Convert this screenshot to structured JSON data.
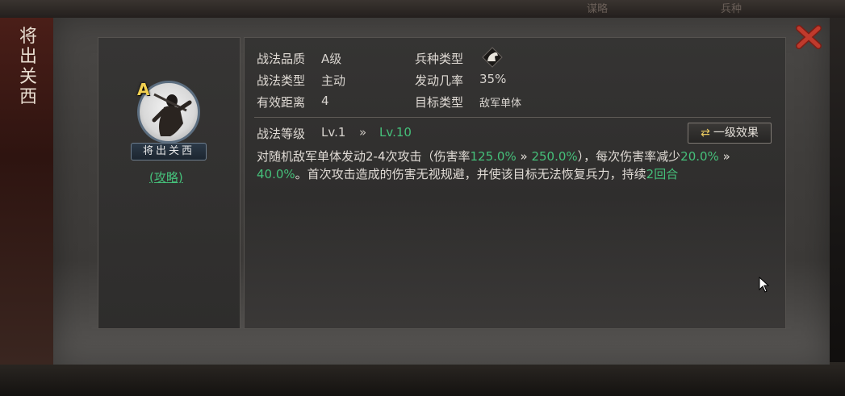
{
  "background": {
    "top_tabs": [
      "谋略",
      "兵种"
    ]
  },
  "side_title": [
    "将",
    "出",
    "关",
    "西"
  ],
  "skill": {
    "grade": "A",
    "name": "将出关西",
    "guide_link": "(攻略)"
  },
  "attributes": {
    "quality_label": "战法品质",
    "quality_value": "A级",
    "type_label": "战法类型",
    "type_value": "主动",
    "range_label": "有效距离",
    "range_value": "4",
    "troop_label": "兵种类型",
    "troop_icon": "horse-cavalry-icon",
    "rate_label": "发动几率",
    "rate_value": "35%",
    "target_label": "目标类型",
    "target_value": "敌军单体"
  },
  "level": {
    "label": "战法等级",
    "from": "Lv.1",
    "arrow": "»",
    "to": "Lv.10"
  },
  "effect_button": {
    "icon": "swap-arrows-icon",
    "label": "一级效果"
  },
  "description": {
    "p1": "对随机敌军单体发动2-4次攻击（伤害率",
    "v1": "125.0%",
    "arrow1": " » ",
    "v2": "250.0%",
    "p2": "），每次伤害率减少",
    "v3": "20.0%",
    "arrow2": " » ",
    "v4": "40.0%",
    "p3": "。首次攻击造成的伤害无视规避，并使该目标无法恢复兵力，持续",
    "v5": "2回合"
  },
  "colors": {
    "highlight_green": "#45c07a",
    "grade_gold": "#f2d050",
    "close_red": "#c03a2c"
  }
}
